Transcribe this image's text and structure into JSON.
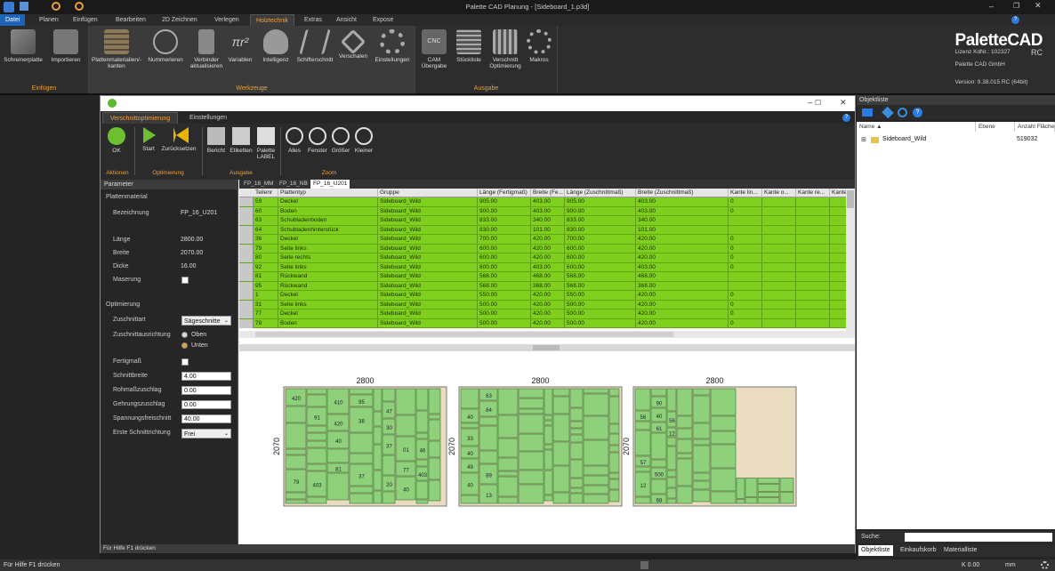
{
  "app": {
    "title": "Palette CAD Planung - [Sideboard_1.p3d]",
    "logo": "PaletteCAD",
    "logo_suffix": "RC",
    "license": "Lizenz KdNr.: 102327",
    "company": "Palette CAD GmbH",
    "version": "Version: 9.38.015 RC (64bit)"
  },
  "ribbon_tabs": [
    "Datei",
    "Planen",
    "Einfügen",
    "Bearbeiten",
    "2D Zeichnen",
    "Verlegen",
    "Holztechnik",
    "Extras",
    "Ansicht",
    "Expose"
  ],
  "ribbon_groups": {
    "einfuegen": {
      "title": "Einfügen",
      "buttons": [
        "Schreinerplatte",
        "Importieren"
      ]
    },
    "werkzeuge": {
      "title": "Werkzeuge",
      "buttons": [
        "Plattenmaterialien/-kanten",
        "Nummerieren",
        "Verbinder aktualisieren",
        "Variablen",
        "Intelligenz",
        "Schifterschnitt",
        "Verschalen",
        "Einstellungen"
      ]
    },
    "ausgabe": {
      "title": "Ausgabe",
      "buttons": [
        "CAM Übergabe",
        "Stückliste",
        "Verschnitt Optimierung",
        "Makros"
      ]
    }
  },
  "dialog": {
    "tabs": [
      "Verschnittoptimierung",
      "Einstellungen"
    ],
    "groups": [
      {
        "title": "Aktionen",
        "buttons": [
          "OK"
        ]
      },
      {
        "title": "Optimierung",
        "buttons": [
          "Start",
          "Zurücksetzen"
        ]
      },
      {
        "title": "Ausgabe",
        "buttons": [
          "Bericht",
          "Etiketten",
          "Palette LABEL"
        ]
      },
      {
        "title": "Zoom",
        "buttons": [
          "Alles",
          "Fenster",
          "Größer",
          "Kleiner"
        ]
      }
    ],
    "status": "Für Hilfe F1 drücken"
  },
  "params": {
    "header": "Parameter",
    "section1": "Plattenmaterial",
    "bezeichnung_label": "Bezeichnung",
    "bezeichnung": "FP_16_U201",
    "laenge_label": "Länge",
    "laenge": "2800.00",
    "breite_label": "Breite",
    "breite": "2070.00",
    "dicke_label": "Dicke",
    "dicke": "16.00",
    "maserung_label": "Maserung",
    "section2": "Optimierung",
    "zuschnittart_label": "Zuschnittart",
    "zuschnittart": "Sägeschnitte",
    "ausrichtung_label": "Zuschnittausrichtung",
    "oben": "Oben",
    "unten": "Unten",
    "fertigmass_label": "Fertigmaß",
    "schnittbreite_label": "Schnittbreite",
    "schnittbreite": "4.00",
    "rohmass_label": "Rohmaßzuschlag",
    "rohmass": "0.00",
    "gehrung_label": "Gehrungszuschlag",
    "gehrung": "0.00",
    "spannung_label": "Spannungsfreischnitt",
    "spannung": "40.00",
    "erste_label": "Erste Schnittrichtung",
    "erste": "Frei"
  },
  "sheet_tabs": [
    "FP_16_MM",
    "FP_16_NB",
    "FP_16_U201"
  ],
  "grid": {
    "columns": [
      "Teilenr",
      "Plattentyp",
      "Gruppe",
      "Länge (Fertigmaß)",
      "Breite (Fe...",
      "Länge (Zuschnittmaß)",
      "Breite (Zuschnittmaß)",
      "Kante lin...",
      "Kante o...",
      "Kante re...",
      "Kante..."
    ],
    "rows": [
      [
        "59",
        "Deckel",
        "Sideboard_Wild",
        "905.00",
        "403.00",
        "905.00",
        "403.00",
        "0"
      ],
      [
        "60",
        "Boden",
        "Sideboard_Wild",
        "900.00",
        "403.00",
        "900.00",
        "403.00",
        "0"
      ],
      [
        "63",
        "Schubladenboden",
        "Sideboard_Wild",
        "833.00",
        "340.00",
        "833.00",
        "340.00",
        ""
      ],
      [
        "64",
        "Schubladenhinterstück",
        "Sideboard_Wild",
        "830.00",
        "101.00",
        "830.00",
        "101.00",
        ""
      ],
      [
        "36",
        "Deckel",
        "Sideboard_Wild",
        "700.00",
        "420.00",
        "700.00",
        "420.00",
        "0"
      ],
      [
        "79",
        "Seite links",
        "Sideboard_Wild",
        "600.00",
        "420.00",
        "600.00",
        "420.00",
        "0"
      ],
      [
        "80",
        "Seite rechts",
        "Sideboard_Wild",
        "600.00",
        "420.00",
        "600.00",
        "420.00",
        "0"
      ],
      [
        "92",
        "Seite links",
        "Sideboard_Wild",
        "600.00",
        "403.00",
        "600.00",
        "403.00",
        "0"
      ],
      [
        "81",
        "Rückwand",
        "Sideboard_Wild",
        "568.00",
        "468.00",
        "568.00",
        "468.00",
        ""
      ],
      [
        "95",
        "Rückwand",
        "Sideboard_Wild",
        "568.00",
        "368.00",
        "568.00",
        "368.00",
        ""
      ],
      [
        "1",
        "Deckel",
        "Sideboard_Wild",
        "550.00",
        "420.00",
        "550.00",
        "420.00",
        "0"
      ],
      [
        "31",
        "Seite links",
        "Sideboard_Wild",
        "500.00",
        "420.00",
        "500.00",
        "420.00",
        "0"
      ],
      [
        "77",
        "Deckel",
        "Sideboard_Wild",
        "500.00",
        "420.00",
        "500.00",
        "420.00",
        "0"
      ],
      [
        "78",
        "Boden",
        "Sideboard_Wild",
        "500.00",
        "420.00",
        "500.00",
        "420.00",
        "0"
      ]
    ]
  },
  "drawing": {
    "sheet_width": "2800",
    "sheet_height": "2070",
    "labels_sheet1": [
      "420",
      "79",
      "91",
      "403",
      "410",
      "420",
      "40",
      "81",
      "95",
      "38",
      "37",
      "47",
      "30",
      "37",
      "20",
      "01",
      "77",
      "40",
      "46",
      "403"
    ],
    "labels_sheet2": [
      "40",
      "33",
      "40",
      "49",
      "40",
      "63",
      "84",
      "89",
      "13"
    ],
    "labels_sheet3": [
      "56",
      "57",
      "12",
      "90",
      "40",
      "61",
      "500",
      "68",
      "56",
      "12"
    ]
  },
  "objektliste": {
    "title": "Objektliste",
    "columns": [
      "Name",
      "Ebene",
      "Anzahl Fläche"
    ],
    "item": "Sideboard_Wild",
    "item_count": "519032",
    "search_label": "Suche:",
    "tabs": [
      "Objektliste",
      "Einkaufskorb",
      "Materialliste"
    ]
  },
  "statusbar": {
    "help": "Für Hilfe F1 drücken",
    "coord": "K 0.00",
    "unit": "mm"
  },
  "colors": {
    "accent": "#e8a13a",
    "row_green": "#7fd01e",
    "part_green": "#8fd07a",
    "sheet_beige": "#e9dcc0"
  }
}
